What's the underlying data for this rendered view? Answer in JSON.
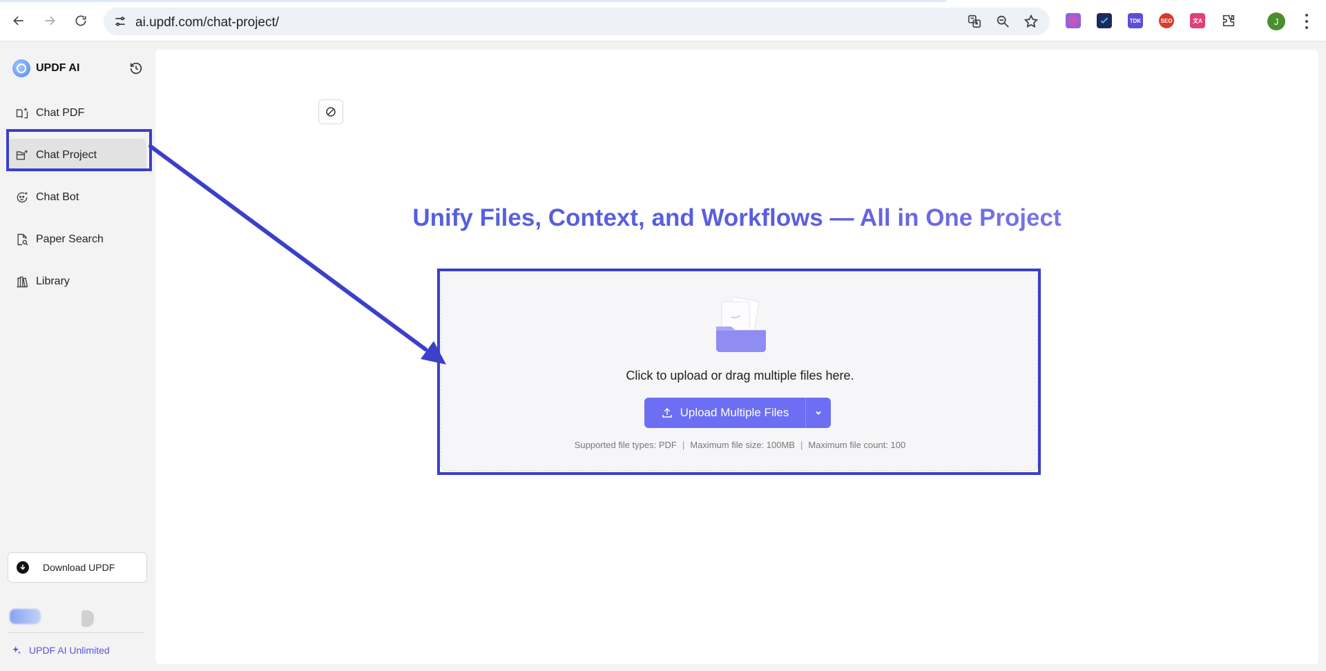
{
  "browser": {
    "url": "ai.updf.com/chat-project/",
    "profile_initial": "J",
    "extensions": [
      "brain-ext-icon",
      "check-ext-icon",
      "tdk-ext-icon",
      "seo-ext-icon",
      "translate-ext-icon"
    ],
    "ext_labels": {
      "tdk": "TDK",
      "seo": "SEO",
      "translate": "文A"
    }
  },
  "sidebar": {
    "brand": "UPDF AI",
    "items": [
      {
        "label": "Chat PDF",
        "icon": "book-plus-icon"
      },
      {
        "label": "Chat Project",
        "icon": "folder-plus-icon",
        "active": true
      },
      {
        "label": "Chat Bot",
        "icon": "bot-icon"
      },
      {
        "label": "Paper Search",
        "icon": "doc-search-icon"
      },
      {
        "label": "Library",
        "icon": "library-icon"
      }
    ],
    "download_label": "Download UPDF",
    "unlimited_label": "UPDF AI Unlimited"
  },
  "main": {
    "title": "Unify Files, Context, and Workflows — All in One Project",
    "drop_text": "Click to upload or drag multiple files here.",
    "upload_label": "Upload Multiple Files",
    "file_types": "Supported file types: PDF",
    "max_size": "Maximum file size: 100MB",
    "max_count": "Maximum file count: 100"
  },
  "colors": {
    "accent": "#6c6ef3",
    "annotation": "#3b3fc9"
  }
}
